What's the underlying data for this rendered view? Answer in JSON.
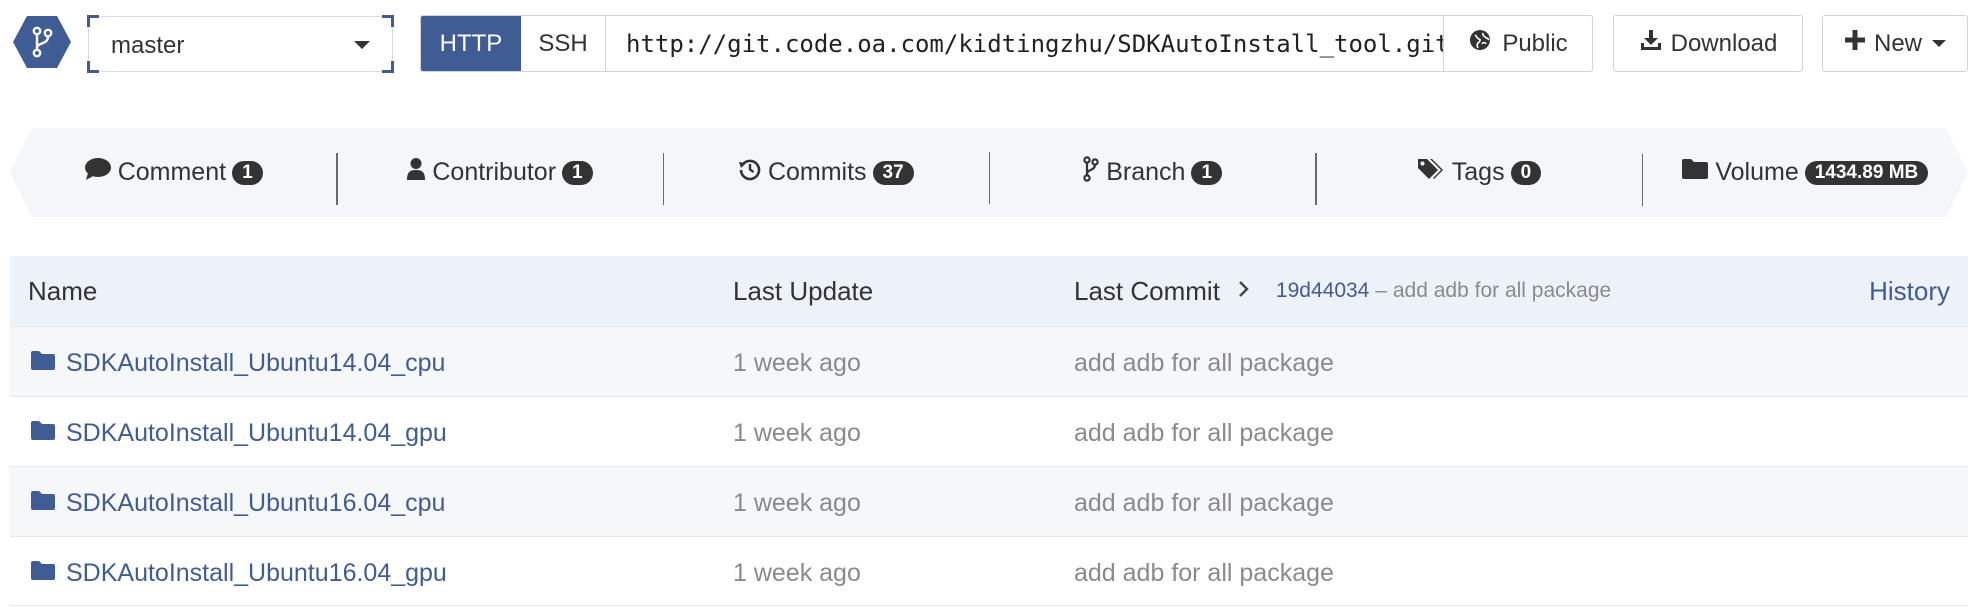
{
  "colors": {
    "accent": "#3f5c95",
    "badge_bg": "#333333",
    "header_bg": "#edf1f8",
    "stats_bg": "#f4f6f9",
    "muted_text": "#8a8a8a"
  },
  "toolbar": {
    "branch_icon": "branch-icon",
    "branch_value": "master",
    "clone": {
      "http_label": "HTTP",
      "ssh_label": "SSH",
      "url": "http://git.code.oa.com/kidtingzhu/SDKAutoInstall_tool.git",
      "visibility_icon": "globe-icon",
      "visibility_label": "Public"
    },
    "download_icon": "download-icon",
    "download_label": "Download",
    "new_icon": "plus-icon",
    "new_label": "New"
  },
  "stats": [
    {
      "icon": "comment-icon",
      "label": "Comment",
      "count": "1"
    },
    {
      "icon": "user-icon",
      "label": "Contributor",
      "count": "1"
    },
    {
      "icon": "history-icon",
      "label": "Commits",
      "count": "37"
    },
    {
      "icon": "branch-icon",
      "label": "Branch",
      "count": "1"
    },
    {
      "icon": "tags-icon",
      "label": "Tags",
      "count": "0"
    },
    {
      "icon": "folder-icon",
      "label": "Volume",
      "count": "1434.89 MB"
    }
  ],
  "table": {
    "headers": {
      "name": "Name",
      "last_update": "Last Update",
      "last_commit": "Last Commit",
      "commit_hash": "19d44034",
      "commit_message": "– add adb for all package",
      "history": "History"
    },
    "rows": [
      {
        "icon": "folder-icon",
        "name": "SDKAutoInstall_Ubuntu14.04_cpu",
        "updated": "1 week ago",
        "commit": "add adb for all package"
      },
      {
        "icon": "folder-icon",
        "name": "SDKAutoInstall_Ubuntu14.04_gpu",
        "updated": "1 week ago",
        "commit": "add adb for all package"
      },
      {
        "icon": "folder-icon",
        "name": "SDKAutoInstall_Ubuntu16.04_cpu",
        "updated": "1 week ago",
        "commit": "add adb for all package"
      },
      {
        "icon": "folder-icon",
        "name": "SDKAutoInstall_Ubuntu16.04_gpu",
        "updated": "1 week ago",
        "commit": "add adb for all package"
      }
    ]
  }
}
